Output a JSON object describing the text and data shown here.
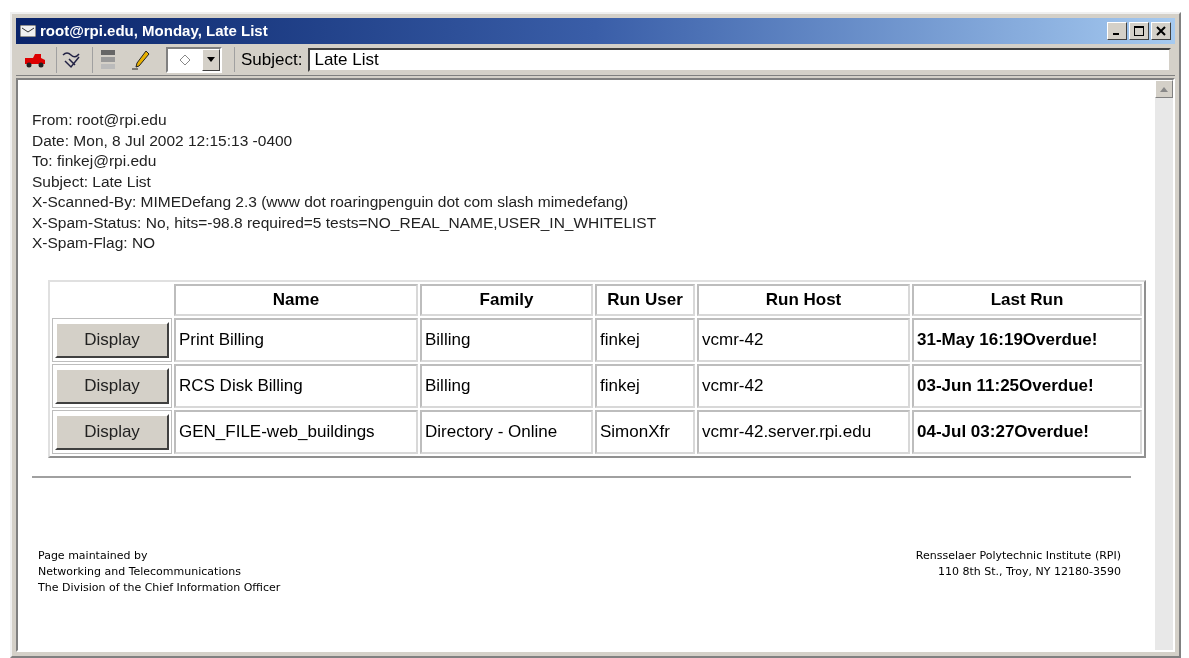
{
  "window": {
    "title": "root@rpi.edu, Monday, Late List"
  },
  "toolbar": {
    "subject_label": "Subject:",
    "subject_value": "Late List"
  },
  "headers": [
    {
      "text": "From: root@rpi.edu"
    },
    {
      "text": "Date: Mon, 8 Jul 2002 12:15:13 -0400"
    },
    {
      "text": "To: finkej@rpi.edu"
    },
    {
      "text": "Subject: Late List"
    },
    {
      "text": "X-Scanned-By: MIMEDefang 2.3 (www dot roaringpenguin dot com slash mimedefang)"
    },
    {
      "text": "X-Spam-Status: No, hits=-98.8 required=5 tests=NO_REAL_NAME,USER_IN_WHITELIST"
    },
    {
      "text": "X-Spam-Flag: NO"
    }
  ],
  "table": {
    "columns": [
      "Name",
      "Family",
      "Run User",
      "Run Host",
      "Last Run"
    ],
    "rows": [
      {
        "button": "Display",
        "cells": [
          "Print Billing",
          "Billing",
          "finkej",
          "vcmr-42",
          "31-May 16:19Overdue!"
        ]
      },
      {
        "button": "Display",
        "cells": [
          "RCS Disk Billing",
          "Billing",
          "finkej",
          "vcmr-42",
          "03-Jun 11:25Overdue!"
        ]
      },
      {
        "button": "Display",
        "cells": [
          "GEN_FILE-web_buildings",
          "Directory - Online",
          "SimonXfr",
          "vcmr-42.server.rpi.edu",
          "04-Jul 03:27Overdue!"
        ]
      }
    ]
  },
  "footer": {
    "left": [
      "Page maintained by",
      "Networking and Telecommunications",
      "The Division of the Chief Information Officer"
    ],
    "right": [
      "Rensselaer Polytechnic Institute (RPI)",
      "110 8th St., Troy, NY 12180-3590"
    ]
  }
}
